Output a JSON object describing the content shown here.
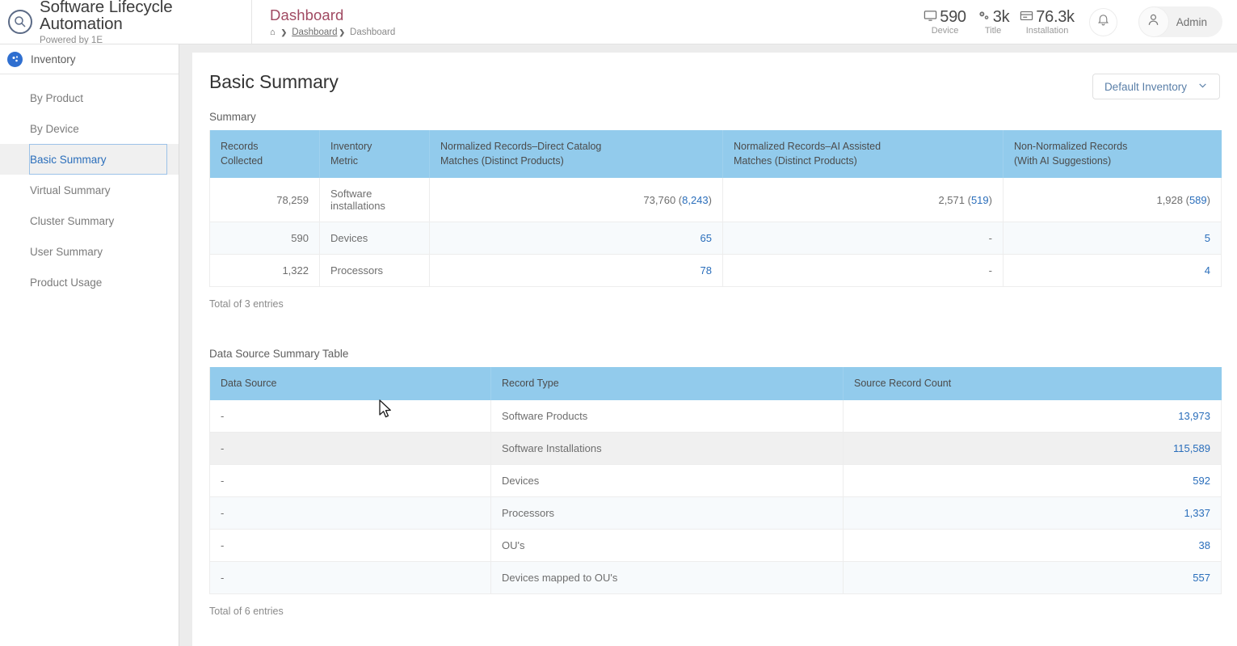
{
  "topbar": {
    "brand_title": "Software Lifecycle Automation",
    "brand_subtitle": "Powered by 1E",
    "brand_logo_icon": "magnifier-circle-icon",
    "page_title": "Dashboard",
    "breadcrumb": {
      "home_icon": "home-icon",
      "separator": "❯",
      "link": "Dashboard",
      "current": "Dashboard"
    },
    "stats": [
      {
        "icon": "monitor-icon",
        "value": "590",
        "label": "Device"
      },
      {
        "icon": "gears-icon",
        "value": "3k",
        "label": "Title"
      },
      {
        "icon": "server-icon",
        "value": "76.3k",
        "label": "Installation"
      }
    ],
    "notification_icon": "bell-icon",
    "user": {
      "avatar_icon": "user-icon",
      "name": "Admin"
    }
  },
  "sidebar": {
    "header": {
      "icon": "inventory-icon",
      "label": "Inventory"
    },
    "items": [
      {
        "label": "By Product",
        "active": false
      },
      {
        "label": "By Device",
        "active": false
      },
      {
        "label": "Basic Summary",
        "active": true
      },
      {
        "label": "Virtual Summary",
        "active": false
      },
      {
        "label": "Cluster Summary",
        "active": false
      },
      {
        "label": "User Summary",
        "active": false
      },
      {
        "label": "Product Usage",
        "active": false
      }
    ]
  },
  "main": {
    "heading": "Basic Summary",
    "inventory_selector": {
      "label": "Default Inventory",
      "icon": "chevron-down-icon"
    },
    "summary": {
      "caption": "Summary",
      "columns": [
        "Records\nCollected",
        "Inventory\nMetric",
        "Normalized Records–Direct Catalog\nMatches (Distinct Products)",
        "Normalized Records–AI Assisted\nMatches (Distinct Products)",
        "Non-Normalized Records\n(With AI Suggestions)"
      ],
      "columns_l1": [
        "Records",
        "Inventory",
        "Normalized Records–Direct Catalog",
        "Normalized Records–AI Assisted",
        "Non-Normalized Records"
      ],
      "columns_l2": [
        "Collected",
        "Metric",
        "Matches (Distinct Products)",
        "Matches (Distinct Products)",
        "(With AI Suggestions)"
      ],
      "rows": [
        {
          "records_collected": "78,259",
          "inventory_metric": "Software installations",
          "direct_main": "73,760 (",
          "direct_link": "8,243",
          "direct_close": ")",
          "ai_main": "2,571 (",
          "ai_link": "519",
          "ai_close": ")",
          "non_main": "1,928 (",
          "non_link": "589",
          "non_close": ")"
        },
        {
          "records_collected": "590",
          "inventory_metric": "Devices",
          "direct_main": "",
          "direct_link": "65",
          "direct_close": "",
          "ai_main": "",
          "ai_link": "-",
          "ai_close": "",
          "non_main": "",
          "non_link": "5",
          "non_close": ""
        },
        {
          "records_collected": "1,322",
          "inventory_metric": "Processors",
          "direct_main": "",
          "direct_link": "78",
          "direct_close": "",
          "ai_main": "",
          "ai_link": "-",
          "ai_close": "",
          "non_main": "",
          "non_link": "4",
          "non_close": ""
        }
      ],
      "total": "Total of 3 entries"
    },
    "datasource": {
      "caption": "Data Source Summary Table",
      "columns": [
        "Data Source",
        "Record Type",
        "Source Record Count"
      ],
      "rows": [
        {
          "data_source": "-",
          "record_type": "Software Products",
          "count": "13,973"
        },
        {
          "data_source": "-",
          "record_type": "Software Installations",
          "count": "115,589"
        },
        {
          "data_source": "-",
          "record_type": "Devices",
          "count": "592"
        },
        {
          "data_source": "-",
          "record_type": "Processors",
          "count": "1,337"
        },
        {
          "data_source": "-",
          "record_type": "OU's",
          "count": "38"
        },
        {
          "data_source": "-",
          "record_type": "Devices mapped to OU's",
          "count": "557"
        }
      ],
      "total": "Total of 6 entries"
    }
  },
  "colors": {
    "table_header": "#92cbec",
    "link": "#2a6ebb",
    "page_title": "#a04a62",
    "accent_blue": "#2f6fd0",
    "row_hover": "#f0f0f0",
    "row_alt": "#f7fafc"
  }
}
